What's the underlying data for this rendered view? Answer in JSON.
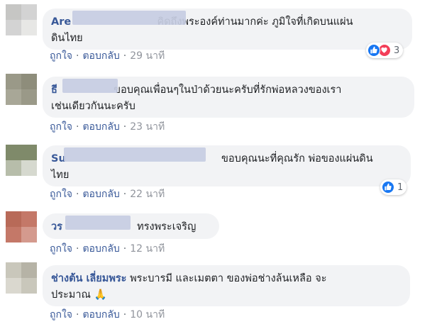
{
  "comments": [
    {
      "author": "Are",
      "text_line1": "คิดถึงพระองค์ท่านมากค่ะ ภูมิใจที่เกิดบนแผ่น",
      "text_line2": "ดินไทย",
      "like": "ถูกใจ",
      "reply": "ตอบกลับ",
      "time": "29 นาที",
      "reaction_count": "3",
      "reaction_icons": [
        "like-icon",
        "love-icon"
      ]
    },
    {
      "author": "ธี",
      "text_line1": "ขอบคุณเพื่อนๆในป่าด้วยนะครับที่รักพ่อหลวงของเรา",
      "text_line2": "เช่นเดียวกันนะครับ",
      "like": "ถูกใจ",
      "reply": "ตอบกลับ",
      "time": "23 นาที"
    },
    {
      "author": "Su",
      "text_line1": "ขอบคุณนะที่คุณรัก พ่อของแผ่นดิน",
      "text_line2": "ไทย",
      "like": "ถูกใจ",
      "reply": "ตอบกลับ",
      "time": "22 นาที",
      "reaction_count": "1",
      "reaction_icons": [
        "like-icon"
      ]
    },
    {
      "author": "วร",
      "text_line1": "ทรงพระเจริญ",
      "like": "ถูกใจ",
      "reply": "ตอบกลับ",
      "time": "12 นาที"
    },
    {
      "author": "ช่างต้น เลี่ยมพระ",
      "text_line1": "พระบารมี และเมตตา ของพ่อช่างล้นเหลือ จะ",
      "text_line2": "ประมาณ",
      "emoji": "🙏",
      "like": "ถูกใจ",
      "reply": "ตอบกลับ",
      "time": "10 นาที"
    }
  ],
  "separator": "·",
  "colors": {
    "link": "#385898",
    "bubble": "#f2f3f5",
    "like_blue": "#1877f2",
    "love_red": "#f33e58"
  }
}
